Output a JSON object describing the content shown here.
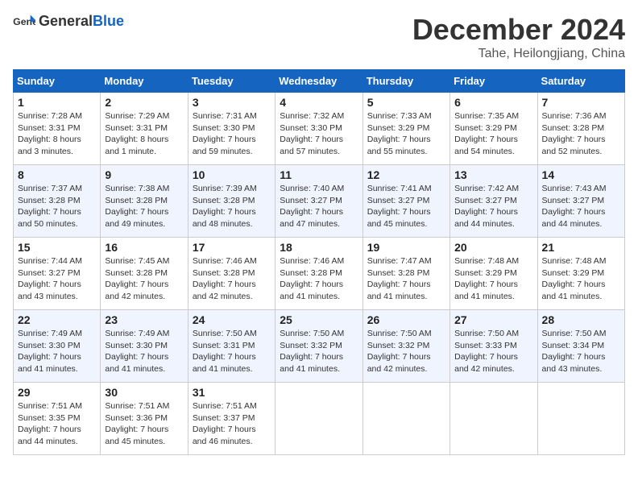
{
  "logo": {
    "text_general": "General",
    "text_blue": "Blue"
  },
  "title": "December 2024",
  "location": "Tahe, Heilongjiang, China",
  "weekdays": [
    "Sunday",
    "Monday",
    "Tuesday",
    "Wednesday",
    "Thursday",
    "Friday",
    "Saturday"
  ],
  "weeks": [
    [
      {
        "day": "1",
        "info": "Sunrise: 7:28 AM\nSunset: 3:31 PM\nDaylight: 8 hours\nand 3 minutes."
      },
      {
        "day": "2",
        "info": "Sunrise: 7:29 AM\nSunset: 3:31 PM\nDaylight: 8 hours\nand 1 minute."
      },
      {
        "day": "3",
        "info": "Sunrise: 7:31 AM\nSunset: 3:30 PM\nDaylight: 7 hours\nand 59 minutes."
      },
      {
        "day": "4",
        "info": "Sunrise: 7:32 AM\nSunset: 3:30 PM\nDaylight: 7 hours\nand 57 minutes."
      },
      {
        "day": "5",
        "info": "Sunrise: 7:33 AM\nSunset: 3:29 PM\nDaylight: 7 hours\nand 55 minutes."
      },
      {
        "day": "6",
        "info": "Sunrise: 7:35 AM\nSunset: 3:29 PM\nDaylight: 7 hours\nand 54 minutes."
      },
      {
        "day": "7",
        "info": "Sunrise: 7:36 AM\nSunset: 3:28 PM\nDaylight: 7 hours\nand 52 minutes."
      }
    ],
    [
      {
        "day": "8",
        "info": "Sunrise: 7:37 AM\nSunset: 3:28 PM\nDaylight: 7 hours\nand 50 minutes."
      },
      {
        "day": "9",
        "info": "Sunrise: 7:38 AM\nSunset: 3:28 PM\nDaylight: 7 hours\nand 49 minutes."
      },
      {
        "day": "10",
        "info": "Sunrise: 7:39 AM\nSunset: 3:28 PM\nDaylight: 7 hours\nand 48 minutes."
      },
      {
        "day": "11",
        "info": "Sunrise: 7:40 AM\nSunset: 3:27 PM\nDaylight: 7 hours\nand 47 minutes."
      },
      {
        "day": "12",
        "info": "Sunrise: 7:41 AM\nSunset: 3:27 PM\nDaylight: 7 hours\nand 45 minutes."
      },
      {
        "day": "13",
        "info": "Sunrise: 7:42 AM\nSunset: 3:27 PM\nDaylight: 7 hours\nand 44 minutes."
      },
      {
        "day": "14",
        "info": "Sunrise: 7:43 AM\nSunset: 3:27 PM\nDaylight: 7 hours\nand 44 minutes."
      }
    ],
    [
      {
        "day": "15",
        "info": "Sunrise: 7:44 AM\nSunset: 3:27 PM\nDaylight: 7 hours\nand 43 minutes."
      },
      {
        "day": "16",
        "info": "Sunrise: 7:45 AM\nSunset: 3:28 PM\nDaylight: 7 hours\nand 42 minutes."
      },
      {
        "day": "17",
        "info": "Sunrise: 7:46 AM\nSunset: 3:28 PM\nDaylight: 7 hours\nand 42 minutes."
      },
      {
        "day": "18",
        "info": "Sunrise: 7:46 AM\nSunset: 3:28 PM\nDaylight: 7 hours\nand 41 minutes."
      },
      {
        "day": "19",
        "info": "Sunrise: 7:47 AM\nSunset: 3:28 PM\nDaylight: 7 hours\nand 41 minutes."
      },
      {
        "day": "20",
        "info": "Sunrise: 7:48 AM\nSunset: 3:29 PM\nDaylight: 7 hours\nand 41 minutes."
      },
      {
        "day": "21",
        "info": "Sunrise: 7:48 AM\nSunset: 3:29 PM\nDaylight: 7 hours\nand 41 minutes."
      }
    ],
    [
      {
        "day": "22",
        "info": "Sunrise: 7:49 AM\nSunset: 3:30 PM\nDaylight: 7 hours\nand 41 minutes."
      },
      {
        "day": "23",
        "info": "Sunrise: 7:49 AM\nSunset: 3:30 PM\nDaylight: 7 hours\nand 41 minutes."
      },
      {
        "day": "24",
        "info": "Sunrise: 7:50 AM\nSunset: 3:31 PM\nDaylight: 7 hours\nand 41 minutes."
      },
      {
        "day": "25",
        "info": "Sunrise: 7:50 AM\nSunset: 3:32 PM\nDaylight: 7 hours\nand 41 minutes."
      },
      {
        "day": "26",
        "info": "Sunrise: 7:50 AM\nSunset: 3:32 PM\nDaylight: 7 hours\nand 42 minutes."
      },
      {
        "day": "27",
        "info": "Sunrise: 7:50 AM\nSunset: 3:33 PM\nDaylight: 7 hours\nand 42 minutes."
      },
      {
        "day": "28",
        "info": "Sunrise: 7:50 AM\nSunset: 3:34 PM\nDaylight: 7 hours\nand 43 minutes."
      }
    ],
    [
      {
        "day": "29",
        "info": "Sunrise: 7:51 AM\nSunset: 3:35 PM\nDaylight: 7 hours\nand 44 minutes."
      },
      {
        "day": "30",
        "info": "Sunrise: 7:51 AM\nSunset: 3:36 PM\nDaylight: 7 hours\nand 45 minutes."
      },
      {
        "day": "31",
        "info": "Sunrise: 7:51 AM\nSunset: 3:37 PM\nDaylight: 7 hours\nand 46 minutes."
      },
      null,
      null,
      null,
      null
    ]
  ]
}
